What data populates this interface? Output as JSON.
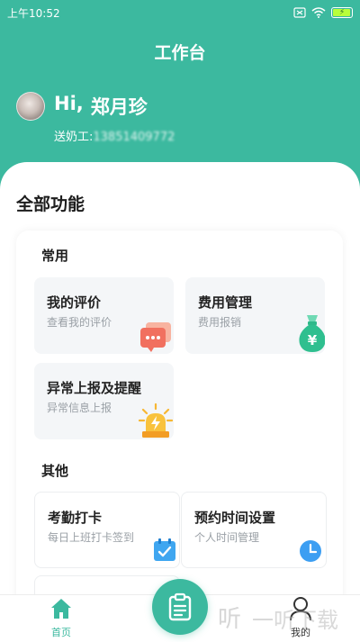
{
  "status_bar": {
    "time": "上午10:52",
    "battery_icon": "battery-charging-icon",
    "wifi_icon": "wifi-icon"
  },
  "header": {
    "title": "工作台",
    "greeting_prefix": "Hi,",
    "user_name": "郑月珍",
    "role_label": "送奶工:",
    "phone": "13851409772"
  },
  "main": {
    "section_title": "全部功能",
    "groups": [
      {
        "title": "常用",
        "tiles": [
          {
            "title": "我的评价",
            "subtitle": "查看我的评价",
            "icon": "comment-bubble-icon"
          },
          {
            "title": "费用管理",
            "subtitle": "费用报销",
            "icon": "money-bag-icon"
          },
          {
            "title": "异常上报及提醒",
            "subtitle": "异常信息上报",
            "icon": "alarm-light-icon"
          }
        ]
      },
      {
        "title": "其他",
        "tiles": [
          {
            "title": "考勤打卡",
            "subtitle": "每日上班打卡签到",
            "icon": "calendar-check-icon"
          },
          {
            "title": "预约时间设置",
            "subtitle": "个人时间管理",
            "icon": "clock-icon"
          }
        ]
      }
    ]
  },
  "bottom_nav": {
    "home_label": "首页",
    "mine_label": "我的",
    "center_icon": "clipboard-icon"
  },
  "watermark": {
    "text": "一听下载"
  },
  "colors": {
    "primary": "#3cb99f"
  }
}
